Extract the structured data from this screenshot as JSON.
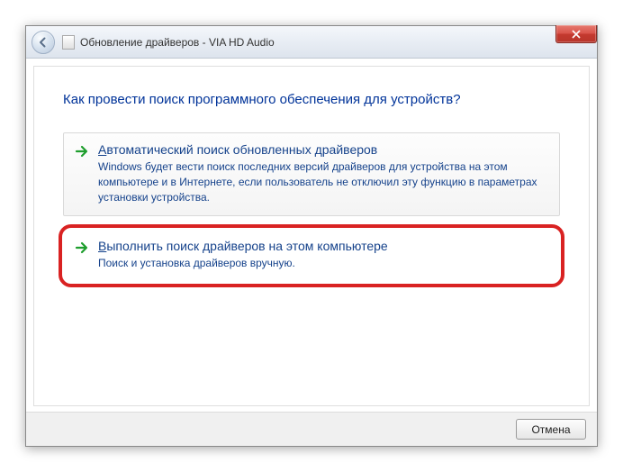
{
  "window": {
    "title": "Обновление драйверов - VIA HD Audio"
  },
  "heading": "Как провести поиск программного обеспечения для устройств?",
  "options": {
    "auto": {
      "accel": "А",
      "title_rest": "втоматический поиск обновленных драйверов",
      "desc": "Windows будет вести поиск последних версий драйверов для устройства на этом компьютере и в Интернете, если пользователь не отключил эту функцию в параметрах установки устройства."
    },
    "manual": {
      "accel": "В",
      "title_rest": "ыполнить поиск драйверов на этом компьютере",
      "desc": "Поиск и установка драйверов вручную."
    }
  },
  "buttons": {
    "cancel": "Отмена"
  }
}
